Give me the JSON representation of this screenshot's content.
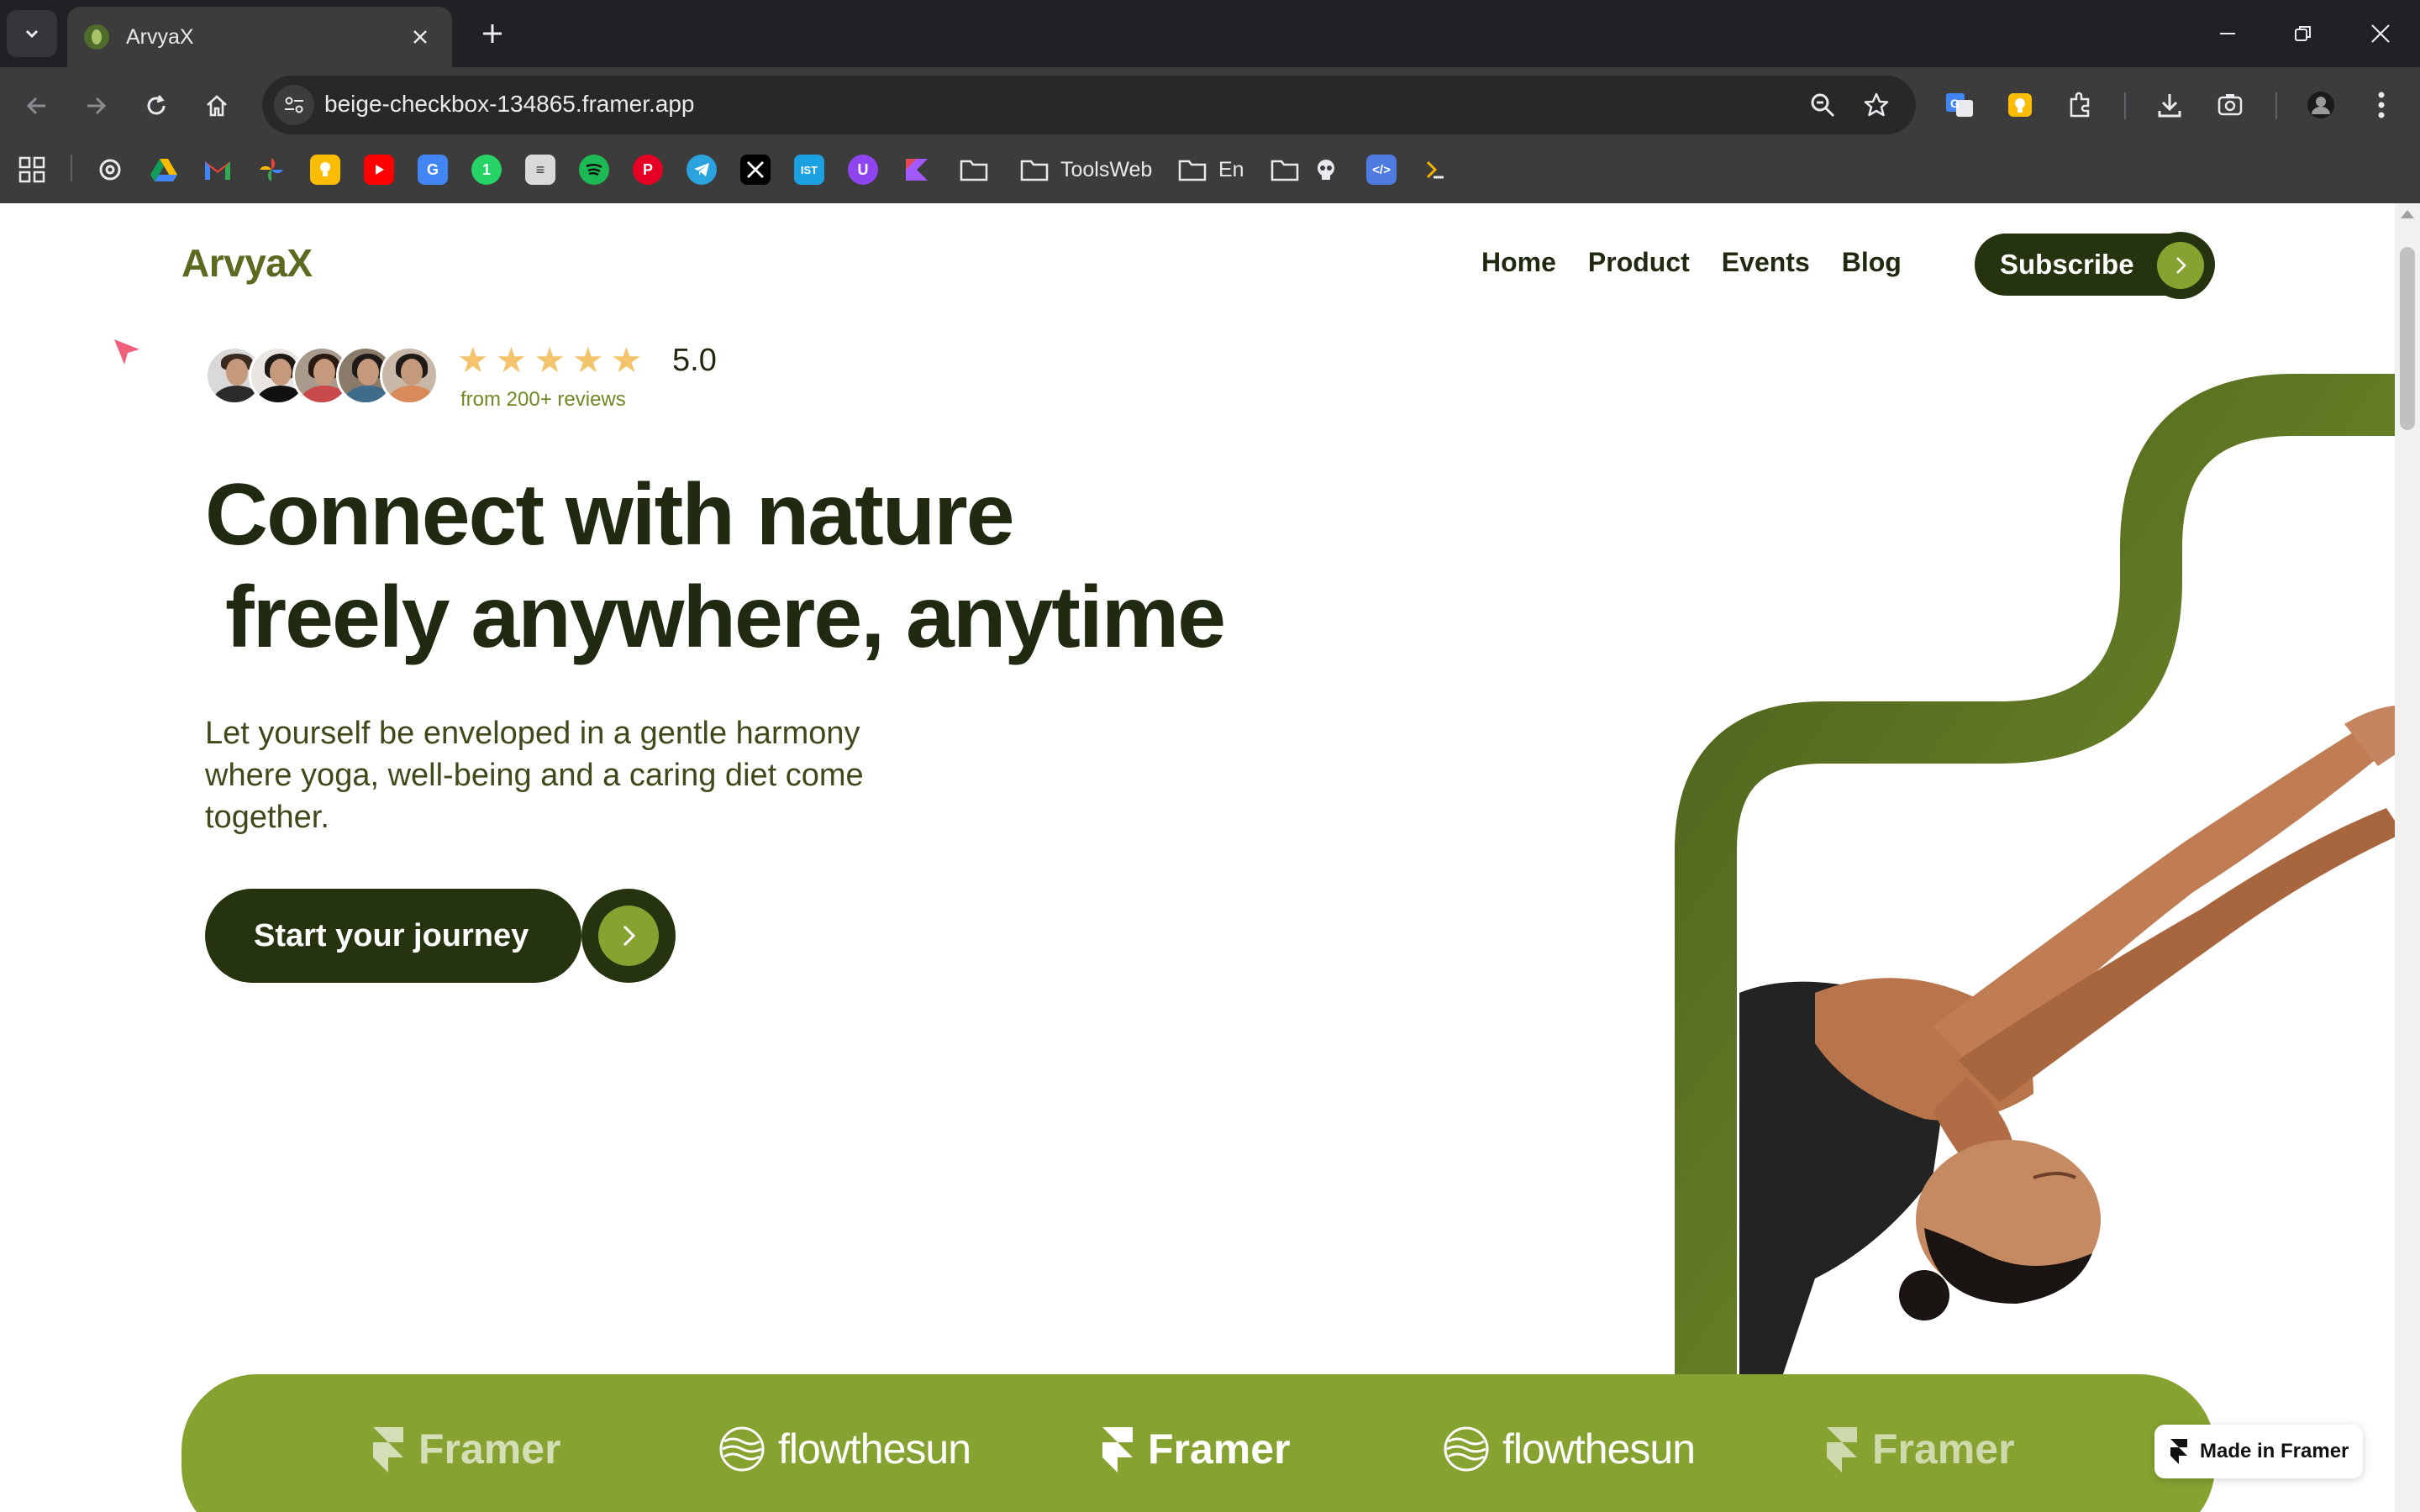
{
  "browser": {
    "tab_title": "ArvyaX",
    "url": "beige-checkbox-134865.framer.app",
    "bookmark_folders": [
      "ToolsWeb",
      "En"
    ]
  },
  "site": {
    "brand": "ArvyaX",
    "nav": [
      "Home",
      "Product",
      "Events",
      "Blog"
    ],
    "subscribe_label": "Subscribe",
    "rating_value": "5.0",
    "rating_stars": 5,
    "reviews_text": "from 200+ reviews",
    "headline_line1": "Connect with nature",
    "headline_line2": "freely anywhere, anytime",
    "subtext": "Let yourself be enveloped in a gentle harmony where yoga, well-being and a caring diet come together.",
    "cta_label": "Start your journey",
    "logos": [
      "Framer",
      "flowthesun",
      "Framer",
      "flowthesun",
      "Framer"
    ],
    "badge": "Made in Framer"
  },
  "colors": {
    "brand_dark": "#26330f",
    "brand_green": "#86a230",
    "ribbon": "#6b8428",
    "star": "#f4c46c"
  }
}
